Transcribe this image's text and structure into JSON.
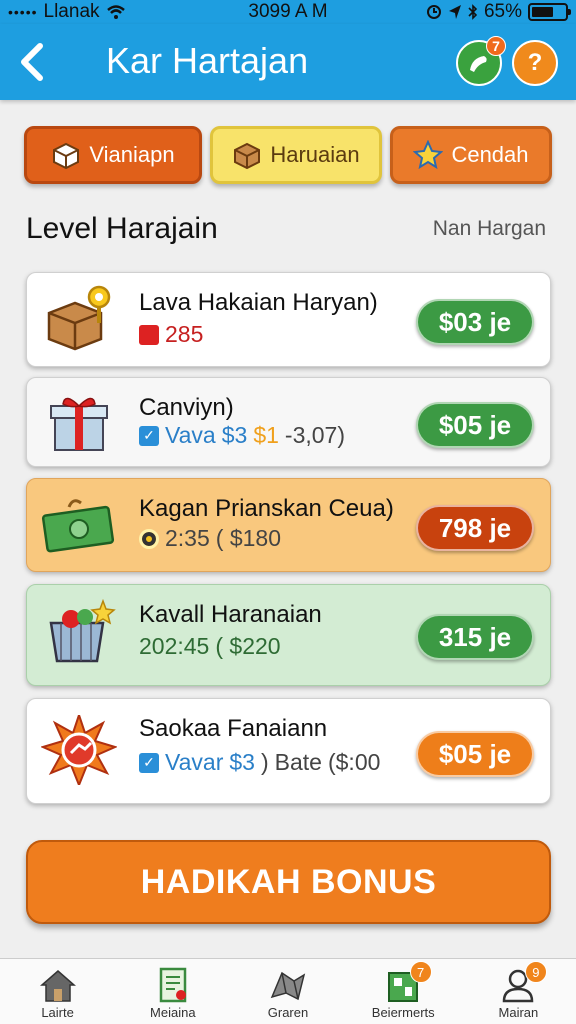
{
  "status_bar": {
    "carrier": "Llanak",
    "signal_dots": "•••••",
    "time": "3099 A M",
    "battery": "65%",
    "battery_level": 0.65
  },
  "header": {
    "title": "Kar Hartajan",
    "back_icon": "chevron-left-icon",
    "action_badge": "7"
  },
  "tabs": [
    {
      "label": "Vianiapn",
      "icon": "box-icon"
    },
    {
      "label": "Haruaian",
      "icon": "box-icon"
    },
    {
      "label": "Cendah",
      "icon": "star-icon"
    }
  ],
  "section": {
    "title": "Level Harajain",
    "side_label": "Nan Hargan"
  },
  "items": [
    {
      "title": "Lava Hakaian Haryan)",
      "sub_value": "285",
      "price": "$03 je",
      "icon": "box-key-icon"
    },
    {
      "title": "Canviyn)",
      "sub_a": "Vava",
      "sub_b": "$3",
      "sub_c": "$1",
      "sub_d": "-3,07)",
      "price": "$05 je",
      "icon": "gift-icon"
    },
    {
      "title": "Kagan Prianskan Ceua)",
      "sub_time": "2:35",
      "sub_amount": "( $180",
      "price": "798 je",
      "icon": "cash-icon"
    },
    {
      "title": "Kavall Haranaian",
      "sub_time": "202:45",
      "sub_amount": "( $220",
      "price": "315 je",
      "icon": "basket-icon"
    },
    {
      "title": "Saokaa Fanaiann",
      "sub_a": "Vavar",
      "sub_b": "$3",
      "sub_c": ")",
      "sub_d": "Bate",
      "sub_e": "($:00",
      "price": "$05 je",
      "icon": "burst-icon"
    }
  ],
  "bonus_button": "HADIKAH BONUS",
  "bottom_nav": [
    {
      "label": "Lairte",
      "icon": "home-icon"
    },
    {
      "label": "Meiaina",
      "icon": "document-icon"
    },
    {
      "label": "Graren",
      "icon": "map-icon"
    },
    {
      "label": "Beiermerts",
      "icon": "board-icon",
      "badge": "7"
    },
    {
      "label": "Mairan",
      "icon": "user-icon",
      "badge": "9"
    }
  ]
}
